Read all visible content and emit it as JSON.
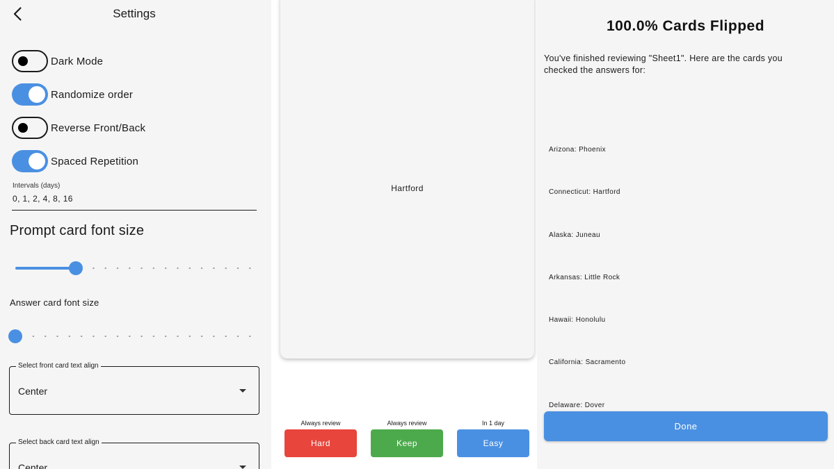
{
  "settings": {
    "title": "Settings",
    "toggles": [
      {
        "label": "Dark Mode",
        "on": false
      },
      {
        "label": "Randomize order",
        "on": true
      },
      {
        "label": "Reverse Front/Back",
        "on": false
      },
      {
        "label": "Spaced Repetition",
        "on": true
      }
    ],
    "intervals_label": "Intervals (days)",
    "intervals_value": "0, 1, 2, 4, 8, 16",
    "prompt_font_size_title": "Prompt card font size",
    "prompt_font_size_level": 0.25,
    "answer_font_size_title": "Answer card font size",
    "answer_font_size_level": 0.0,
    "front_align": {
      "label": "Select front card text align",
      "value": "Center"
    },
    "back_align": {
      "label": "Select back card text align",
      "value": "Center"
    }
  },
  "card": {
    "text": "Hartford",
    "grades": [
      {
        "caption": "Always review",
        "label": "Hard",
        "color": "#e8453c"
      },
      {
        "caption": "Always review",
        "label": "Keep",
        "color": "#4caa4c"
      },
      {
        "caption": "In 1 day",
        "label": "Easy",
        "color": "#4a90e2"
      }
    ]
  },
  "summary": {
    "title": "100.0% Cards Flipped",
    "description": "You've finished reviewing \"Sheet1\". Here are the cards you checked the answers for:",
    "items": [
      "Arizona: Phoenix",
      "Connecticut: Hartford",
      "Alaska: Juneau",
      "Arkansas: Little Rock",
      "Hawaii: Honolulu",
      "California: Sacramento",
      "Delaware: Dover"
    ],
    "done_label": "Done",
    "done_color": "#4a90e2"
  },
  "colors": {
    "accent": "#4a90e2",
    "panel_bg": "#f5f5f5"
  }
}
